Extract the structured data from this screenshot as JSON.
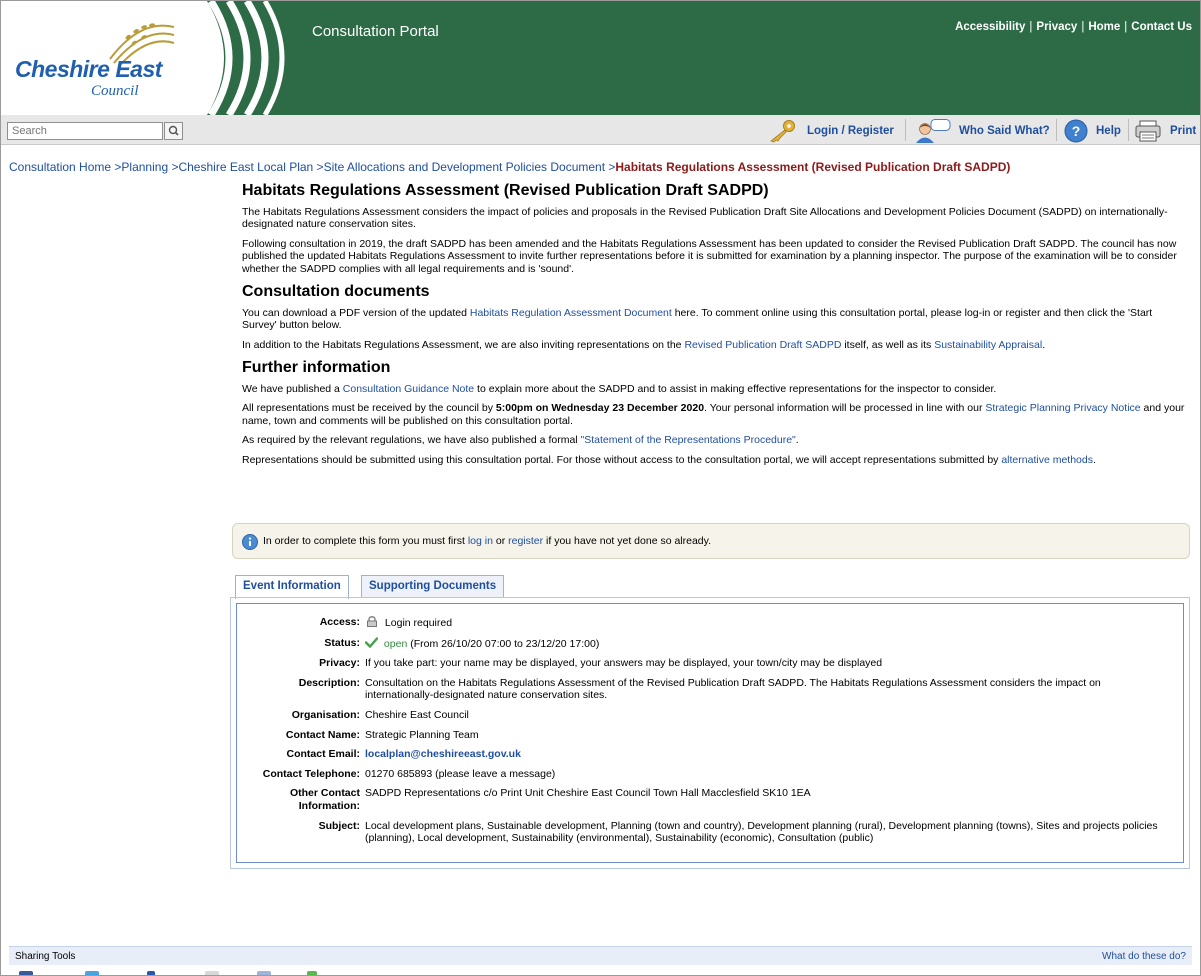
{
  "header": {
    "logo_main": "Cheshire East",
    "logo_sub": "Council",
    "portal_title": "Consultation Portal",
    "top_links": [
      "Accessibility",
      "Privacy",
      "Home",
      "Contact Us"
    ]
  },
  "toolbar": {
    "search_placeholder": "Search",
    "login": "Login / Register",
    "who_said": "Who Said What?",
    "help": "Help",
    "print": "Print"
  },
  "breadcrumb": {
    "items": [
      "Consultation Home",
      "Planning",
      "Cheshire East Local Plan",
      "Site Allocations and Development Policies Document"
    ],
    "current": "Habitats Regulations Assessment (Revised Publication Draft SADPD)"
  },
  "page": {
    "title": "Habitats Regulations Assessment (Revised Publication Draft SADPD)",
    "intro1": "The Habitats Regulations Assessment considers the impact of policies and proposals in the Revised Publication Draft Site Allocations and Development Policies Document (SADPD) on internationally-designated nature conservation sites.",
    "intro2": "Following consultation in 2019, the draft SADPD has been amended and the Habitats Regulations Assessment has been updated to consider the Revised Publication Draft SADPD. The council has now published the updated Habitats Regulations Assessment to invite further representations before it is submitted for examination by a planning inspector. The purpose of the examination will be to consider whether the SADPD complies with all legal requirements and is 'sound'.",
    "h_docs": "Consultation documents",
    "docs1_a": "You can download a PDF version of the updated ",
    "docs1_link": "Habitats Regulation Assessment Document",
    "docs1_b": " here. To comment online using this consultation portal, please log-in or register and then click the 'Start Survey' button below.",
    "docs2_a": "In addition to the Habitats Regulations Assessment, we are also inviting representations on the ",
    "docs2_link1": "Revised Publication Draft SADPD",
    "docs2_b": " itself, as well as its ",
    "docs2_link2": "Sustainability Appraisal",
    "docs2_c": ".",
    "h_further": "Further information",
    "fi1_a": "We have published a ",
    "fi1_link": "Consultation Guidance Note",
    "fi1_b": " to explain more about the SADPD and to assist in making effective representations for the inspector to consider.",
    "fi2_a": "All representations must be received by the council by ",
    "fi2_bold": "5:00pm on Wednesday 23 December 2020",
    "fi2_b": ". Your personal information will be processed in line with our ",
    "fi2_link": "Strategic Planning Privacy Notice",
    "fi2_c": " and your name, town and comments will be published on this consultation portal.",
    "fi3_a": "As required by the relevant regulations, we have also published a formal ",
    "fi3_link": "\"Statement of the Representations Procedure\"",
    "fi3_b": ".",
    "fi4_a": "Representations should be submitted using this consultation portal. For those without access to the consultation portal, we will accept representations submitted by ",
    "fi4_link": "alternative methods",
    "fi4_b": "."
  },
  "notice": {
    "a": "In order to complete this form you must first ",
    "login": "log in",
    "b": " or ",
    "register": "register",
    "c": " if you have not yet done so already."
  },
  "tabs": [
    "Event Information",
    "Supporting Documents"
  ],
  "event": {
    "access_k": "Access:",
    "access_v": "Login required",
    "status_k": "Status:",
    "status_open": "open",
    "status_range": "(From 26/10/20 07:00 to 23/12/20 17:00)",
    "privacy_k": "Privacy:",
    "privacy_v": "If you take part: your name may be displayed, your answers may be displayed, your town/city may be displayed",
    "desc_k": "Description:",
    "desc_v": "Consultation on the Habitats Regulations Assessment of the Revised Publication Draft SADPD. The Habitats Regulations Assessment considers the impact on internationally-designated nature conservation sites.",
    "org_k": "Organisation:",
    "org_v": "Cheshire East Council",
    "cname_k": "Contact Name:",
    "cname_v": "Strategic Planning Team",
    "cemail_k": "Contact Email:",
    "cemail_v": "localplan@cheshireeast.gov.uk",
    "ctel_k": "Contact Telephone:",
    "ctel_v": "01270 685893 (please leave a message)",
    "other_k": "Other Contact Information:",
    "other_v": "SADPD Representations c/o Print Unit Cheshire East Council Town Hall Macclesfield SK10 1EA",
    "subject_k": "Subject:",
    "subject_v": "Local development plans, Sustainable development, Planning (town and country), Development planning (rural), Development planning (towns), Sites and projects policies (planning), Local development, Sustainability (environmental), Sustainability (economic), Consultation (public)"
  },
  "footer": {
    "sharing": "Sharing Tools",
    "what": "What do these do?"
  },
  "colors": {
    "header_green": "#2c6b45",
    "link_blue": "#1f4e9e",
    "current_crumb": "#8b1a1a",
    "status_green": "#2f8a3c"
  }
}
